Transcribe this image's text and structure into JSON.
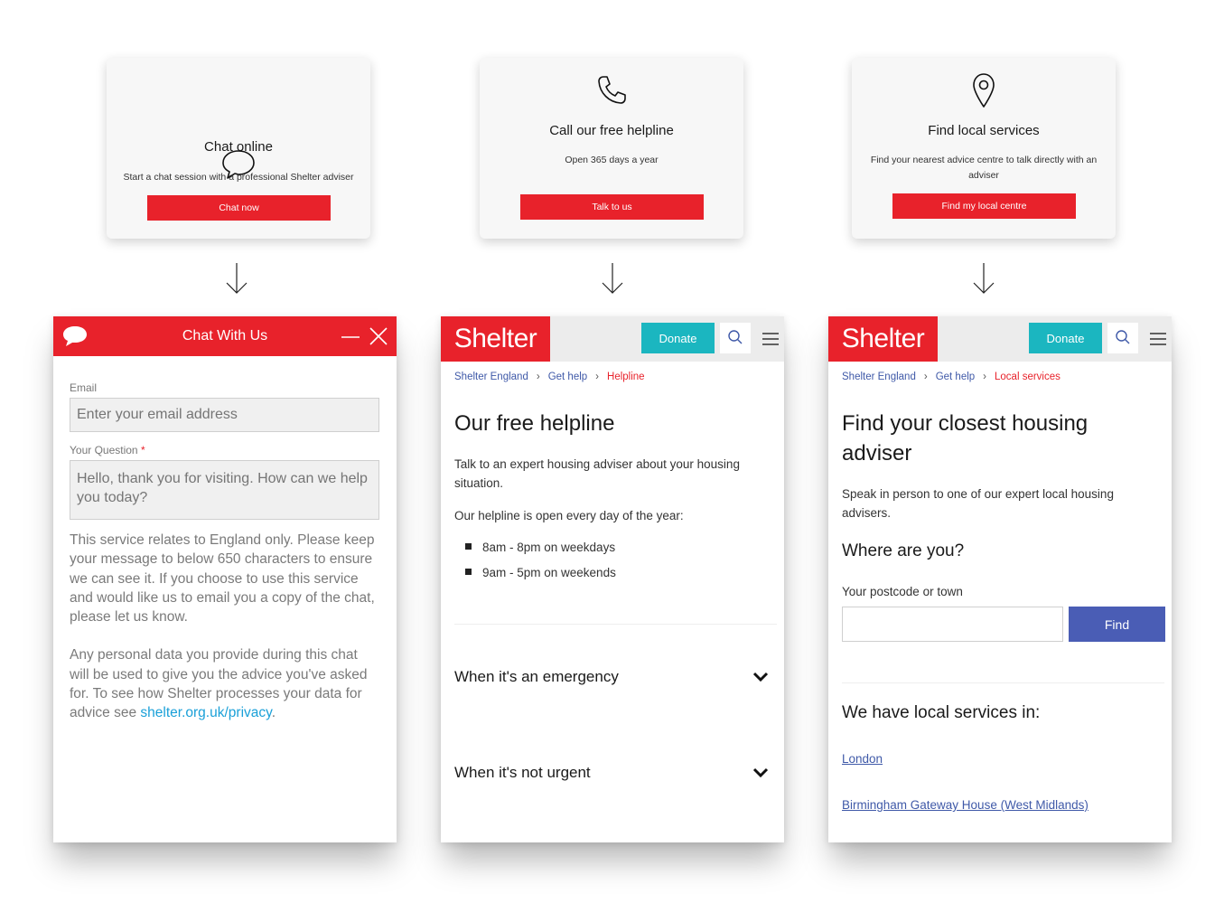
{
  "cards": [
    {
      "title": "Chat online",
      "desc": "Start a chat session with a professional Shelter adviser",
      "button": "Chat now",
      "icon": "speech-bubble-icon"
    },
    {
      "title": "Call our free helpline",
      "desc": "Open 365 days a year",
      "button": "Talk to us",
      "icon": "phone-icon"
    },
    {
      "title": "Find local services",
      "desc": "Find your nearest advice centre to talk directly with an adviser",
      "button": "Find my local centre",
      "icon": "location-pin-icon"
    }
  ],
  "chat": {
    "title": "Chat With Us",
    "email_label": "Email",
    "email_placeholder": "Enter your email address",
    "question_label": "Your Question",
    "required_mark": "*",
    "question_placeholder": "Hello, thank you for visiting. How can we help you today?",
    "notice": "This service relates to England only. Please keep your message to below 650 characters to ensure we can see it. If you choose to use this service and would like us to email you a copy of the chat, please let us know.",
    "privacy_text": "Any personal data you provide during this chat will be used to give you the advice you've asked for. To see how Shelter processes your data for advice see ",
    "privacy_link": "shelter.org.uk/privacy",
    "privacy_end": "."
  },
  "site": {
    "logo": "Shelter",
    "donate": "Donate"
  },
  "helpline": {
    "crumbs": [
      "Shelter England",
      "Get help",
      "Helpline"
    ],
    "title": "Our free helpline",
    "intro": "Talk to an expert housing adviser about your housing situation.",
    "open": "Our helpline is open every day of the year:",
    "hours": [
      "8am - 8pm on weekdays",
      "9am - 5pm on weekends"
    ],
    "accordions": [
      "When it's an emergency",
      "When it's not urgent"
    ]
  },
  "local": {
    "crumbs": [
      "Shelter England",
      "Get help",
      "Local services"
    ],
    "title_line1": "Find your closest housing",
    "title_line2": "adviser",
    "intro": "Speak in person to one of our expert local housing advisers.",
    "where": "Where are you?",
    "postcode_label": "Your postcode or town",
    "postcode_value": "",
    "find": "Find",
    "services_heading": "We have local services in:",
    "services": [
      "London",
      "Birmingham Gateway House (West Midlands)"
    ]
  },
  "colors": {
    "brand_red": "#e8222b",
    "donate_teal": "#1bb6c0",
    "link_blue": "#3f59a8",
    "find_blue": "#4a5db5",
    "privacy_link": "#1aa0d8"
  }
}
